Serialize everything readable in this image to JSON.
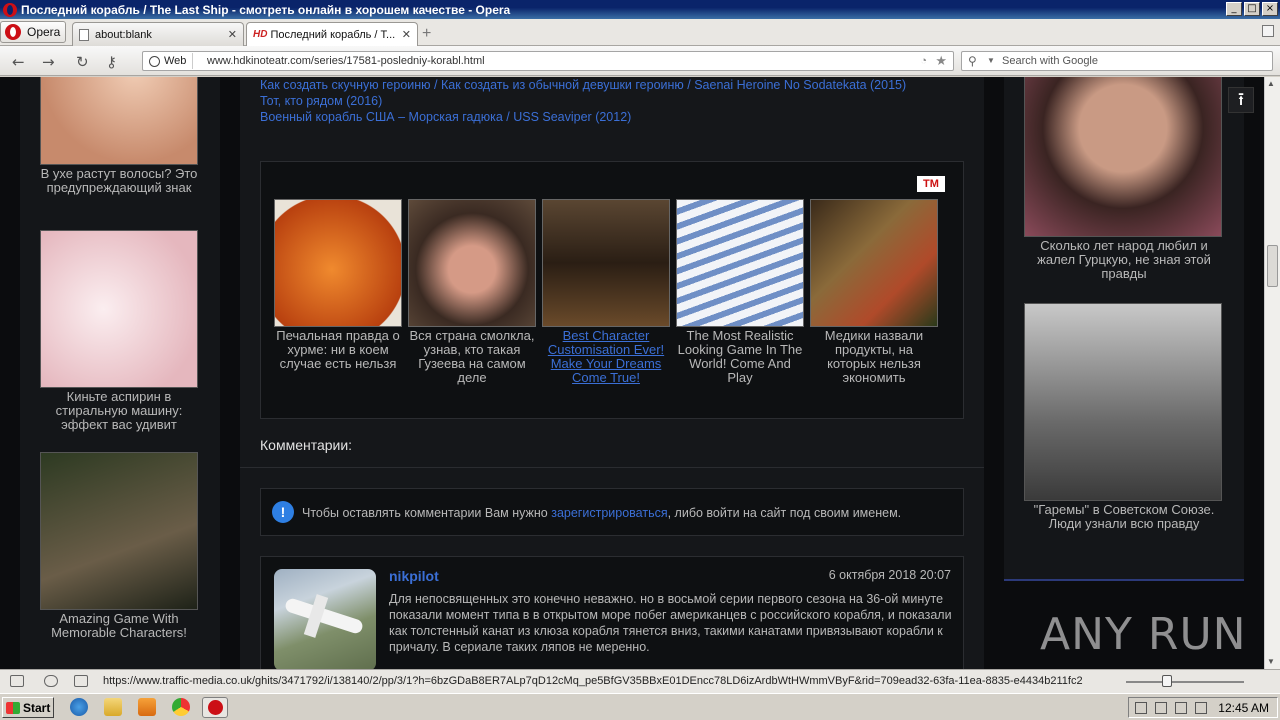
{
  "window": {
    "title": "Последний корабль / The Last Ship - смотреть онлайн в хорошем качестве - Opera"
  },
  "tabs": {
    "menu_label": "Opera",
    "items": [
      {
        "label": "about:blank"
      },
      {
        "label": "Последний корабль / Т...",
        "prefix": "HD"
      }
    ]
  },
  "address": {
    "badge": "Web",
    "url": "www.hdkinoteatr.com/series/17581-posledniy-korabl.html",
    "search_placeholder": "Search with Google"
  },
  "page": {
    "related_links": [
      "Как создать скучную героиню / Как создать из обычной девушки героиню / Saenai Heroine No Sodatekata (2015)",
      "Тот, кто рядом (2016)",
      "Военный корабль США – Морская гадюка / USS Seaviper (2012)"
    ],
    "ad_logo": "TM",
    "ads": [
      {
        "caption": "Печальная правда о хурме: ни в коем случае есть нельзя",
        "link": false,
        "color": "#c5521a"
      },
      {
        "caption": "Вся страна смолкла, узнав, кто такая Гузеева на самом деле",
        "link": false,
        "color": "#6b4a3a"
      },
      {
        "caption": "Best Character Customisation Ever! Make Your Dreams Come True!",
        "link": true,
        "color": "#3a2a1e"
      },
      {
        "caption": "The Most Realistic Looking Game In The World! Come And Play",
        "link": false,
        "color": "#9db4d6"
      },
      {
        "caption": "Медики назвали продукты, на которых нельзя экономить",
        "link": false,
        "color": "#7a5a3a"
      }
    ],
    "comments_title": "Комментарии:",
    "notice": {
      "before": "Чтобы оставлять комментарии Вам нужно ",
      "link": "зарегистрироваться",
      "after": ", либо войти на сайт под своим именем."
    },
    "comment": {
      "user": "nikpilot",
      "date": "6 октября 2018 20:07",
      "text": "Для непосвященных это конечно неважно. но в восьмой серии первого сезона на 36-ой минуте показали момент типа в в открытом море побег американцев с российского корабля, и показали как толстенный канат из клюза корабля тянется вниз, такими канатами привязывают корабли к причалу. В сериале таких ляпов не меренно."
    },
    "left_ads": [
      {
        "caption": "В ухе растут волосы? Это предупреждающий знак",
        "color": "#d6a88a"
      },
      {
        "caption": "Киньте аспирин в стиральную машину: эффект вас удивит",
        "color": "#e9c9cc"
      },
      {
        "caption": "Amazing Game With Memorable Characters!",
        "color": "#5a4a3a"
      }
    ],
    "right_ads": [
      {
        "caption": "Сколько лет народ любил и жалел Гурцкую, не зная этой правды",
        "color": "#b07a6a"
      },
      {
        "caption": "\"Гаремы\" в Советском Союзе. Люди узнали всю правду",
        "color": "#8a8a8a"
      }
    ],
    "watermark": "ANY  RUN"
  },
  "status": {
    "url": "https://www.traffic-media.co.uk/ghits/3471792/i/138140/2/pp/3/1?h=6bzGDaB8ER7ALp7qD12cMq_pe5BfGV35BBxE01DEncc78LD6izArdbWtHWmmVByF&rid=709ead32-63fa-11ea-8835-e4434b211fc2..."
  },
  "taskbar": {
    "start_label": "Start",
    "clock": "12:45 AM"
  }
}
